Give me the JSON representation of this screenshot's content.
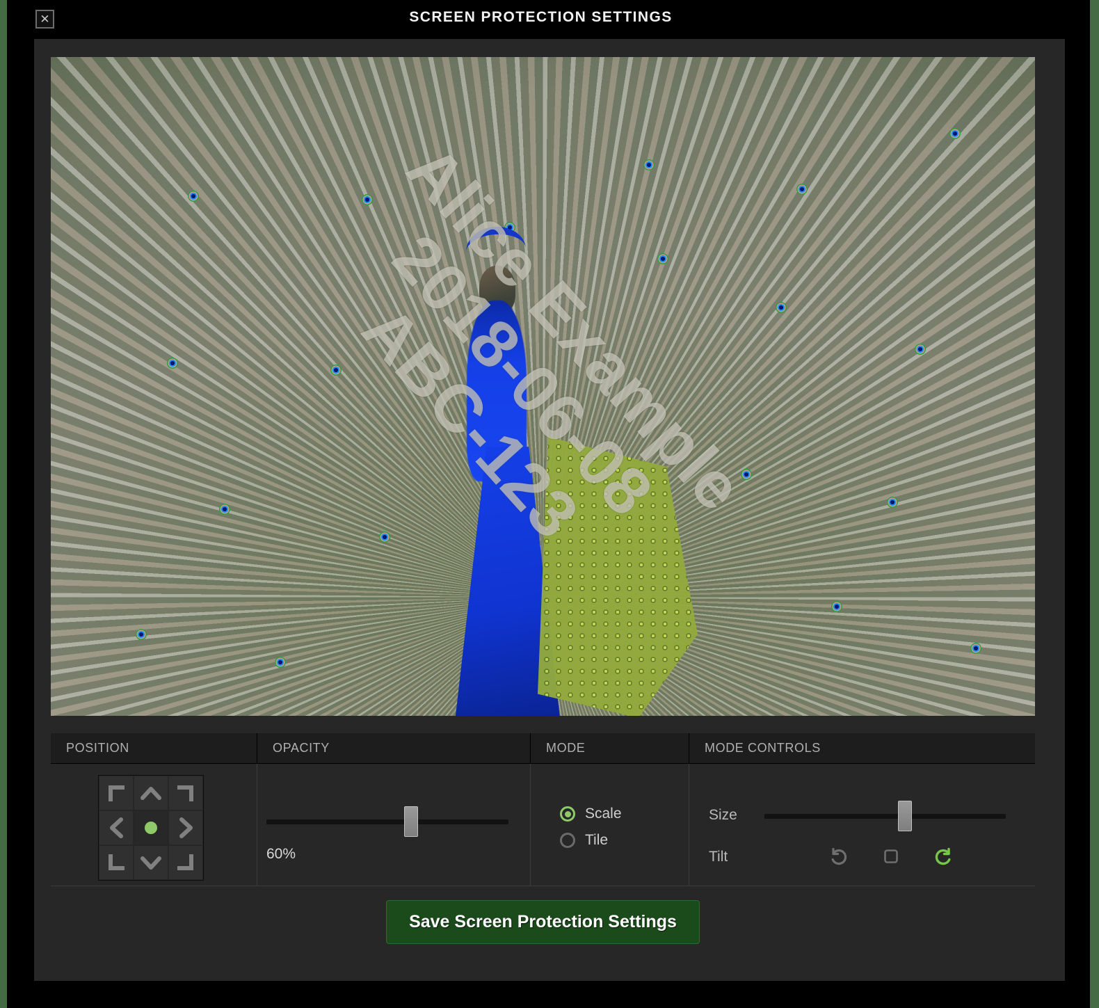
{
  "window": {
    "title": "SCREEN PROTECTION SETTINGS",
    "close_icon": "close-x-icon",
    "close_label": "✕"
  },
  "preview": {
    "image_subject": "peacock with fanned tail feathers",
    "watermark": {
      "line1": "Alice Example",
      "line2": "2018-06-08",
      "line3": "ABC-123",
      "rotation_deg": 48,
      "opacity_percent": 60,
      "color": "#e8e6d8"
    }
  },
  "sections": {
    "position": {
      "header": "POSITION",
      "cells": [
        {
          "name": "top-left",
          "icon": "corner-top-left-icon",
          "active": false
        },
        {
          "name": "top-center",
          "icon": "chevron-up-icon",
          "active": false
        },
        {
          "name": "top-right",
          "icon": "corner-top-right-icon",
          "active": false
        },
        {
          "name": "middle-left",
          "icon": "chevron-left-icon",
          "active": false
        },
        {
          "name": "center",
          "icon": "dot-icon",
          "active": true
        },
        {
          "name": "middle-right",
          "icon": "chevron-right-icon",
          "active": false
        },
        {
          "name": "bottom-left",
          "icon": "corner-bottom-left-icon",
          "active": false
        },
        {
          "name": "bottom-center",
          "icon": "chevron-down-icon",
          "active": false
        },
        {
          "name": "bottom-right",
          "icon": "corner-bottom-right-icon",
          "active": false
        }
      ],
      "selected": "center"
    },
    "opacity": {
      "header": "OPACITY",
      "value_label": "60%",
      "value": 60,
      "min": 0,
      "max": 100
    },
    "mode": {
      "header": "MODE",
      "options": [
        {
          "label": "Scale",
          "selected": true
        },
        {
          "label": "Tile",
          "selected": false
        }
      ]
    },
    "mode_controls": {
      "header": "MODE CONTROLS",
      "size": {
        "label": "Size",
        "value": 58,
        "min": 0,
        "max": 100
      },
      "tilt": {
        "label": "Tilt",
        "buttons": [
          {
            "name": "rotate-counterclockwise",
            "icon": "rotate-ccw-icon",
            "active": false
          },
          {
            "name": "no-tilt",
            "icon": "square-icon",
            "active": false
          },
          {
            "name": "rotate-clockwise",
            "icon": "rotate-cw-icon",
            "active": true
          }
        ]
      }
    }
  },
  "footer": {
    "save_label": "Save Screen Protection Settings"
  },
  "colors": {
    "accent_green": "#8ec96a",
    "save_button_bg": "#1b4a1b",
    "panel_bg": "#272727",
    "header_bg": "#1d1d1d",
    "page_bg": "#456b45"
  }
}
